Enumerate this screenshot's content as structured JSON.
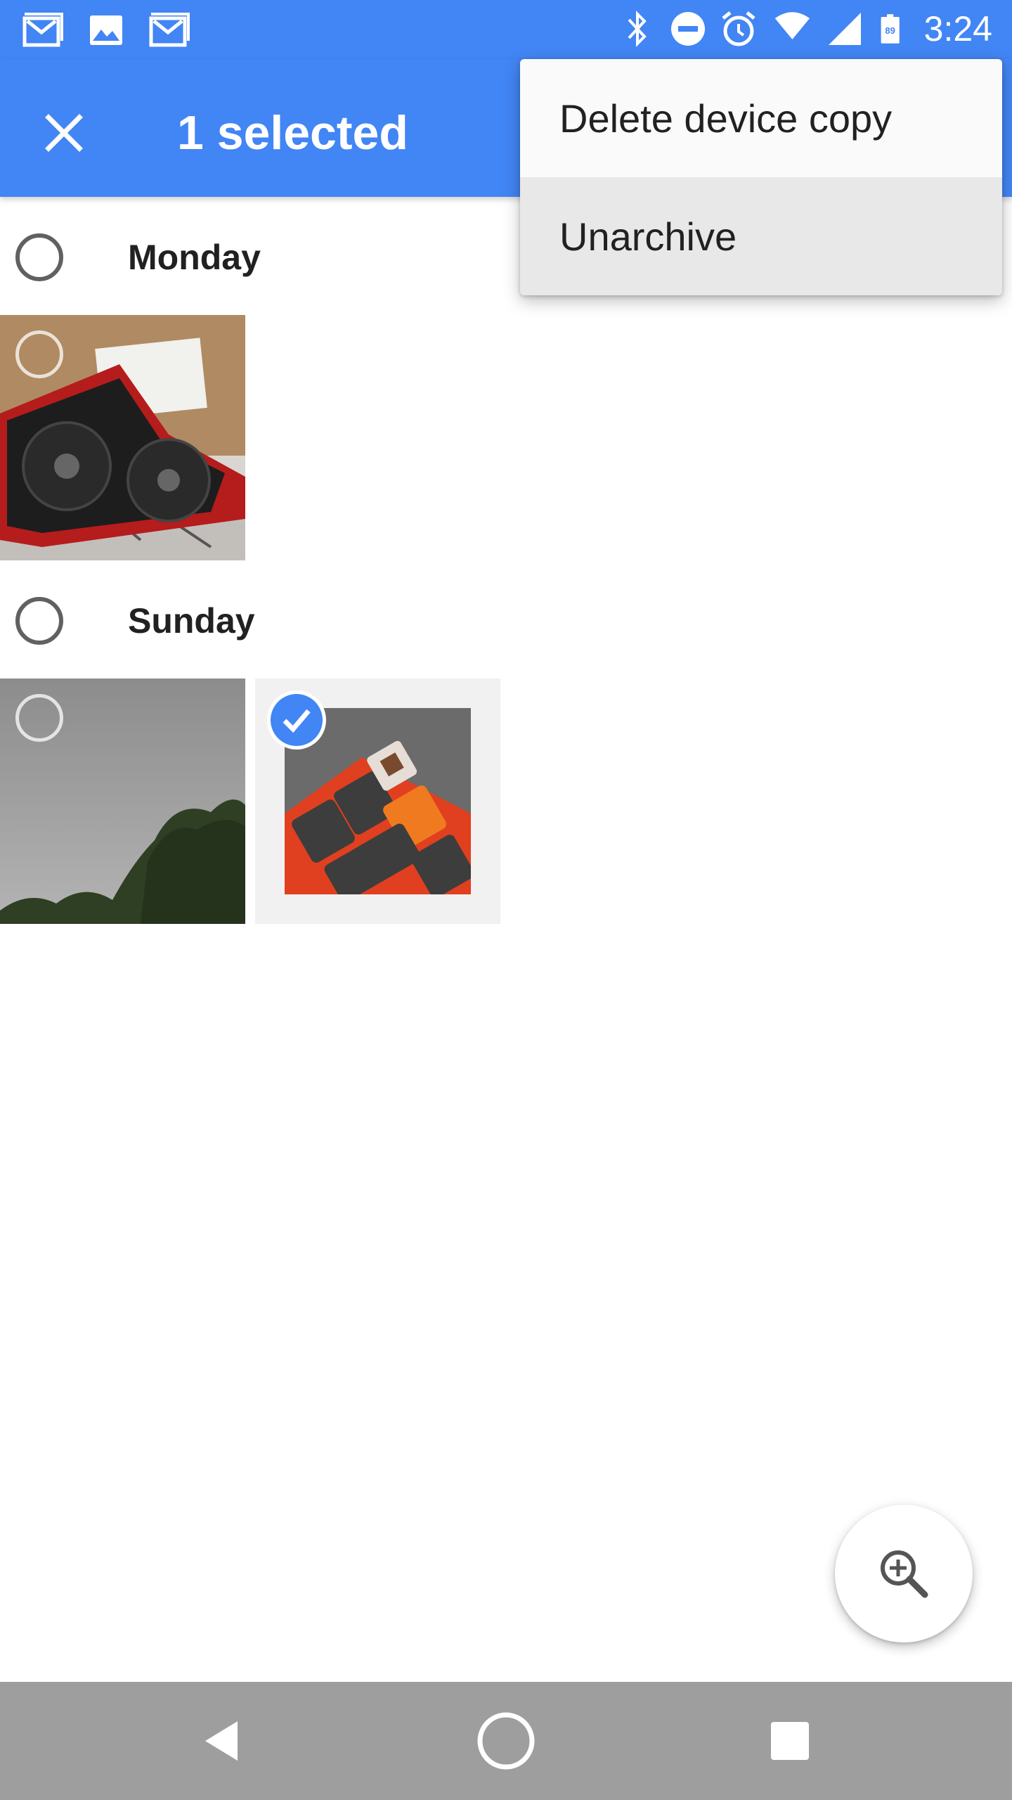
{
  "status_bar": {
    "time": "3:24",
    "battery_level": "89",
    "left_icons": [
      "gmail-icon",
      "image-icon",
      "gmail-icon"
    ],
    "right_icons": [
      "bluetooth-icon",
      "do-not-disturb-icon",
      "alarm-icon",
      "wifi-icon",
      "signal-icon",
      "battery-icon"
    ]
  },
  "app_bar": {
    "title": "1 selected",
    "close_icon": "close-icon",
    "background_color": "#4285f4"
  },
  "menu": {
    "items": [
      {
        "label": "Delete device copy",
        "highlighted": false
      },
      {
        "label": "Unarchive",
        "highlighted": true
      }
    ]
  },
  "sections": [
    {
      "label": "Monday",
      "photos": [
        {
          "description_icon": "graphics-card-photo",
          "selected": false
        }
      ]
    },
    {
      "label": "Sunday",
      "photos": [
        {
          "description_icon": "sky-trees-photo",
          "selected": false
        },
        {
          "description_icon": "keyboard-photo",
          "selected": true
        }
      ]
    }
  ],
  "fab": {
    "icon": "zoom-in-icon"
  },
  "nav_bar": {
    "icons": [
      "back-icon",
      "home-icon",
      "recents-icon"
    ]
  }
}
